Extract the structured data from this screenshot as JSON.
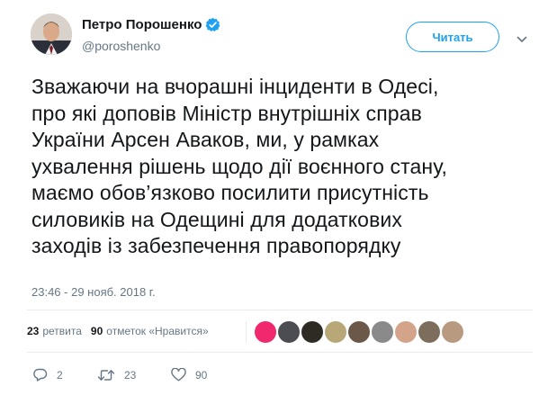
{
  "author": {
    "display_name": "Петро Порошенко",
    "handle": "@poroshenko",
    "verified": true,
    "avatar_icon": "profile-photo"
  },
  "follow_button": {
    "label": "Читать"
  },
  "menu_icon": "chevron-down-icon",
  "tweet": {
    "text": "Зважаючи на вчорашні інциденти в Одесі,\nпро які доповів Міністр внутрішніх справ\nУкраїни Арсен Аваков, ми, у рамках\nухвалення рішень щодо дії воєнного стану,\nмаємо обов’язково посилити присутність\nсиловиків на Одещині для додаткових\nзаходів із забезпечення правопорядку",
    "timestamp": "23:46 - 29 нояб. 2018 г."
  },
  "stats": {
    "retweets_count": "23",
    "retweets_label": "ретвита",
    "likes_count": "90",
    "likes_label": "отметок «Нравится»"
  },
  "likers": [
    "#f0286e",
    "#4b4d52",
    "#2e2b24",
    "#b8a878",
    "#6b5848",
    "#8a8a8a",
    "#d4a48a",
    "#7d6d5d",
    "#b89a80"
  ],
  "actions": {
    "reply_count": "2",
    "retweet_count": "23",
    "like_count": "90"
  },
  "colors": {
    "accent": "#1da1f2",
    "muted": "#657786",
    "text": "#14171a"
  }
}
